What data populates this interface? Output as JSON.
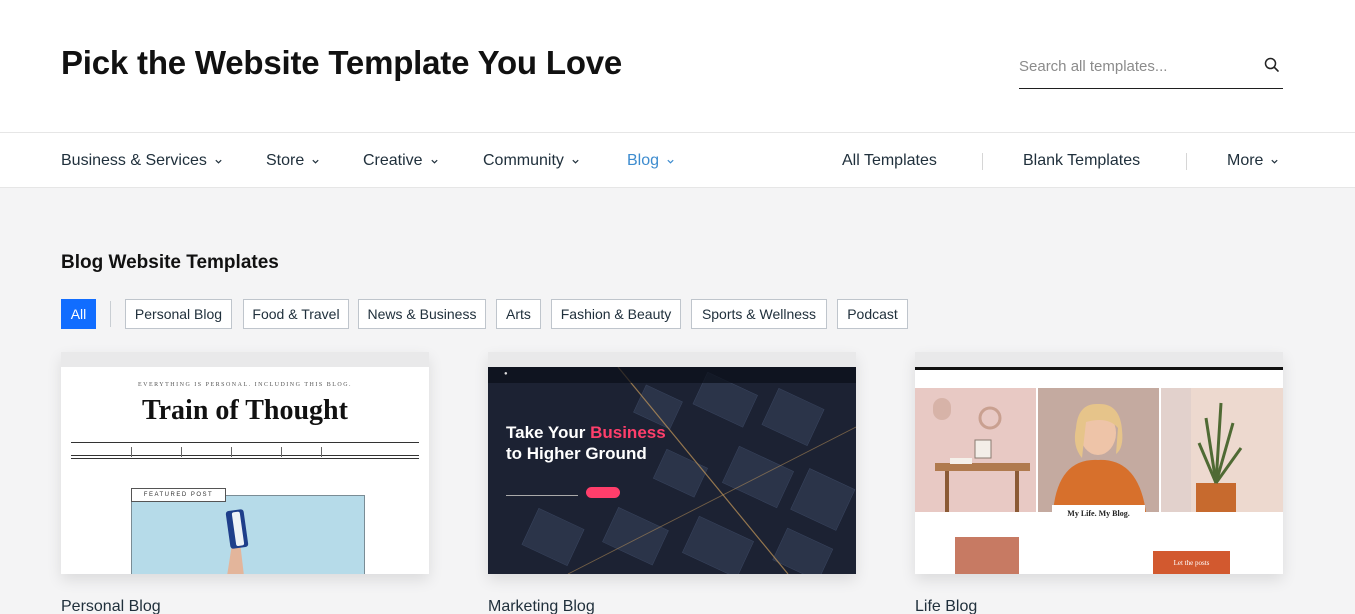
{
  "header": {
    "title": "Pick the Website Template You Love",
    "search_placeholder": "Search all templates..."
  },
  "nav": {
    "categories": [
      {
        "label": "Business & Services"
      },
      {
        "label": "Store"
      },
      {
        "label": "Creative"
      },
      {
        "label": "Community"
      },
      {
        "label": "Blog"
      }
    ],
    "active_category": "Blog",
    "right_links": [
      {
        "label": "All Templates"
      },
      {
        "label": "Blank Templates"
      },
      {
        "label": "More"
      }
    ]
  },
  "section": {
    "title": "Blog Website Templates"
  },
  "filters": [
    {
      "label": "All"
    },
    {
      "label": "Personal Blog"
    },
    {
      "label": "Food & Travel"
    },
    {
      "label": "News & Business"
    },
    {
      "label": "Arts"
    },
    {
      "label": "Fashion & Beauty"
    },
    {
      "label": "Sports & Wellness"
    },
    {
      "label": "Podcast"
    }
  ],
  "active_filter": "All",
  "templates": [
    {
      "name": "Personal Blog",
      "preview": {
        "tagline": "EVERYTHING IS PERSONAL. INCLUDING THIS BLOG.",
        "headline": "Train of Thought",
        "badge": "FEATURED POST"
      }
    },
    {
      "name": "Marketing Blog",
      "preview": {
        "headline_1": "Take Your ",
        "headline_highlight": "Business",
        "headline_2": "to Higher Ground"
      }
    },
    {
      "name": "Life Blog",
      "preview": {
        "overlay": "My Life. My Blog.",
        "button": "Let the posts"
      }
    }
  ],
  "colors": {
    "accent_blue": "#116dff",
    "active_nav": "#3d8ccf",
    "marketing_pink": "#ff3e6b",
    "life_orange": "#d2592f"
  }
}
